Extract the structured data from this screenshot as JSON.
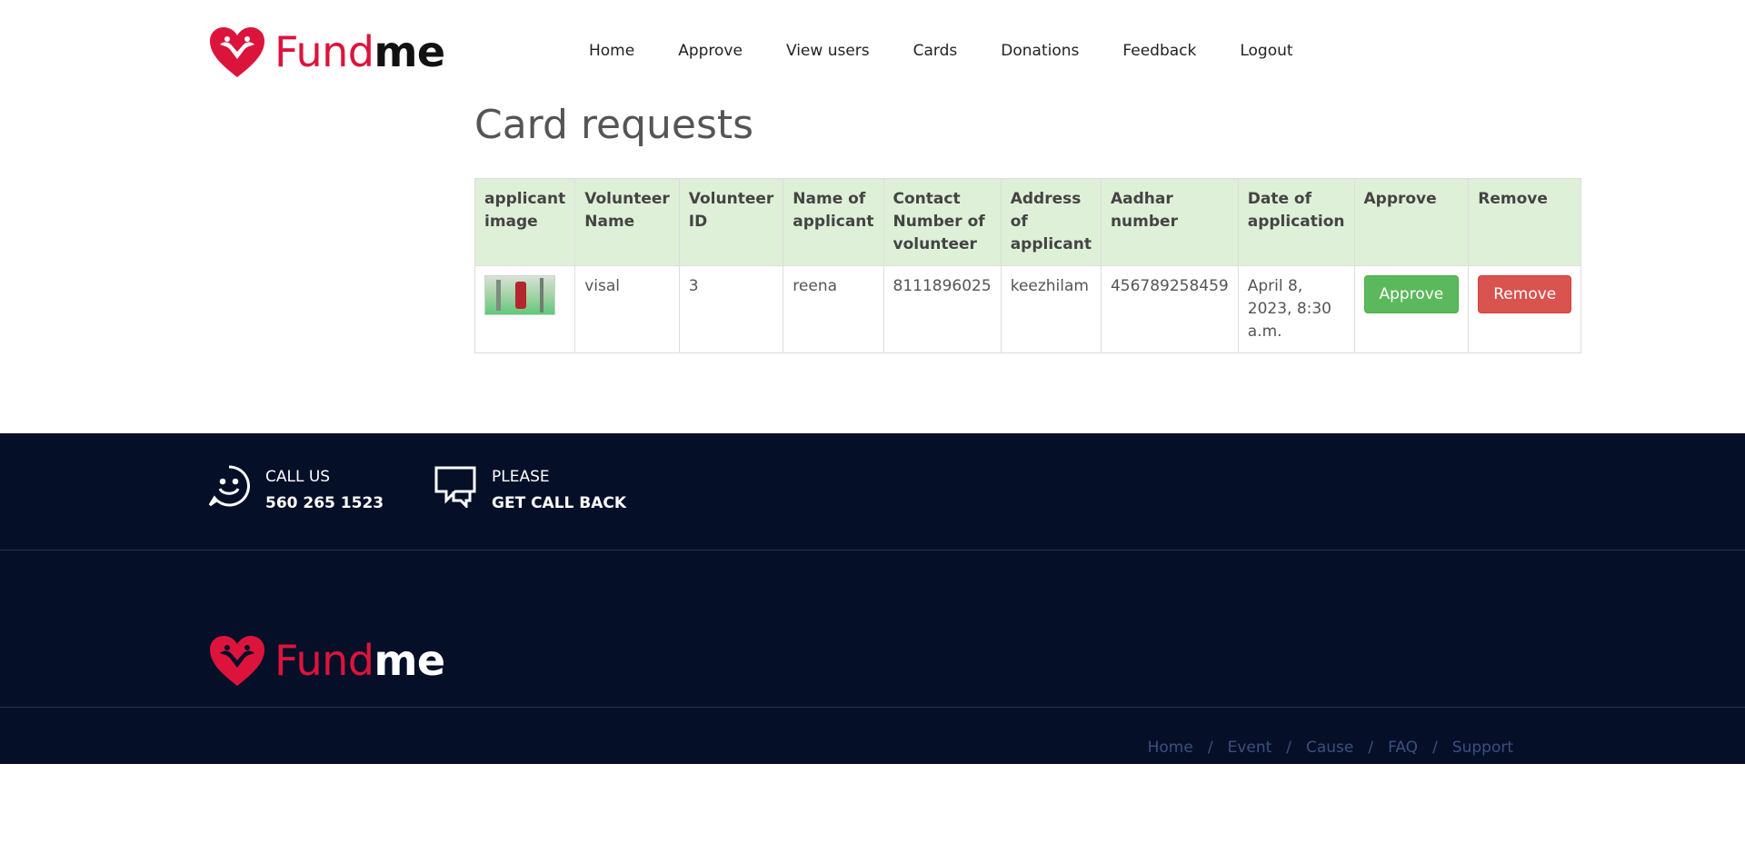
{
  "brand": {
    "name_part1": "Fund",
    "name_part2": "me"
  },
  "nav": {
    "items": [
      "Home",
      "Approve",
      "View users",
      "Cards",
      "Donations",
      "Feedback",
      "Logout"
    ]
  },
  "page": {
    "title": "Card requests"
  },
  "table": {
    "headers": [
      "applicant image",
      "Volunteer Name",
      "Volunteer ID",
      "Name of applicant",
      "Contact Number of volunteer",
      "Address of applicant",
      "Aadhar number",
      "Date of application",
      "Approve",
      "Remove"
    ],
    "rows": [
      {
        "volunteer_name": "visal",
        "volunteer_id": "3",
        "applicant_name": "reena",
        "contact": "8111896025",
        "address": "keezhilam",
        "aadhar": "456789258459",
        "date": "April 8, 2023, 8:30 a.m.",
        "approve_label": "Approve",
        "remove_label": "Remove"
      }
    ]
  },
  "footer": {
    "call_us_label": "CALL US",
    "call_us_number": "560 265 1523",
    "callback_label": "PLEASE",
    "callback_action": "GET CALL BACK",
    "links": [
      "Home",
      "Event",
      "Cause",
      "FAQ",
      "Support"
    ]
  },
  "colors": {
    "brand_red": "#dc143c",
    "footer_bg": "#050f28",
    "header_row": "#dff0d8",
    "approve_green": "#5cb85c",
    "remove_red": "#d9534f"
  },
  "icons": [
    "heart-hands-logo-icon",
    "smiley-phone-icon",
    "chat-bubbles-icon"
  ]
}
